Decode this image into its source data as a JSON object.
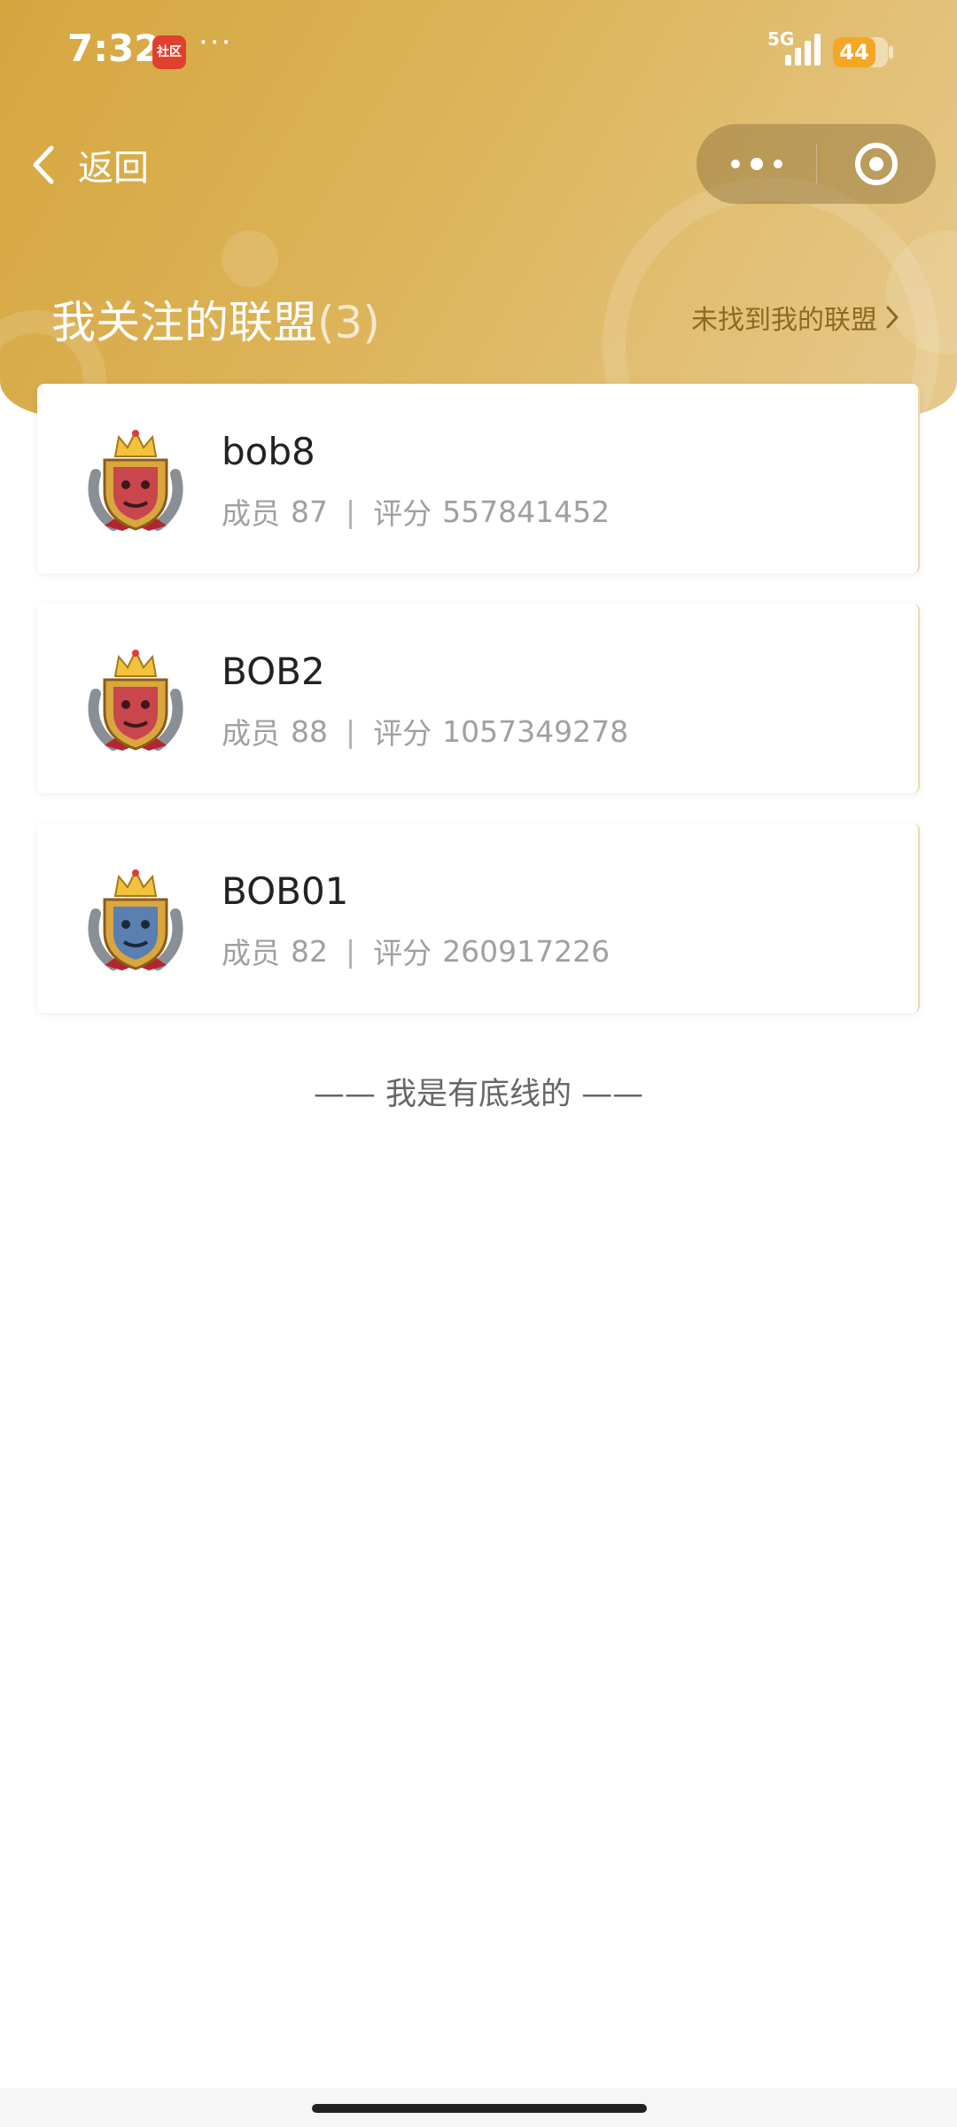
{
  "status_bar": {
    "time": "7:32",
    "app_badge": "社区",
    "dots": "···",
    "network": "5G",
    "battery": "44",
    "battery_level": 0.44
  },
  "nav": {
    "back_label": "返回"
  },
  "section": {
    "title": "我关注的联盟",
    "count": "(3)",
    "not_found_link": "未找到我的联盟"
  },
  "alliances": [
    {
      "name": "bob8",
      "members_label": "成员",
      "members": "87",
      "separator": "|",
      "score_label": "评分",
      "score": "557841452",
      "emblem_color": "#c8464c"
    },
    {
      "name": "BOB2",
      "members_label": "成员",
      "members": "88",
      "separator": "|",
      "score_label": "评分",
      "score": "1057349278",
      "emblem_color": "#c8464c"
    },
    {
      "name": "BOB01",
      "members_label": "成员",
      "members": "82",
      "separator": "|",
      "score_label": "评分",
      "score": "260917226",
      "emblem_color": "#5a7fb0"
    }
  ],
  "footer_note": "—— 我是有底线的 ——",
  "colors": {
    "header_gold": "#d6a63f",
    "link_gold": "#8c6a1f",
    "battery_orange": "#f5a623"
  }
}
